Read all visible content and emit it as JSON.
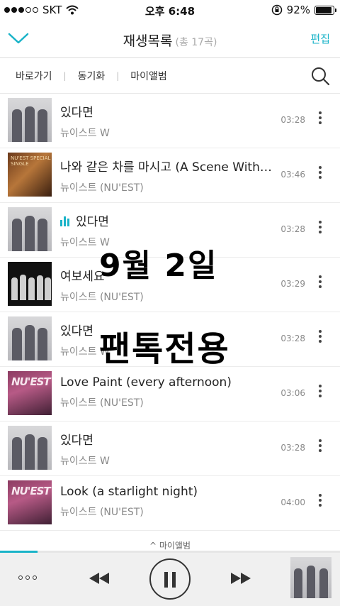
{
  "status_bar": {
    "carrier": "SKT",
    "time": "오후 6:48",
    "battery": "92%",
    "battery_level": 0.92
  },
  "header": {
    "title": "재생목록",
    "count": "(총 17곡)",
    "edit_label": "편집"
  },
  "subnav": {
    "links": [
      "바로가기",
      "동기화",
      "마이앨범"
    ]
  },
  "playlist": [
    {
      "title": "있다면",
      "artist": "뉴이스트 W",
      "duration": "03:28",
      "playing": false
    },
    {
      "title": "나와 같은 차를 마시고 (A Scene With You)",
      "artist": "뉴이스트 (NU'EST)",
      "duration": "03:46",
      "playing": false
    },
    {
      "title": "있다면",
      "artist": "뉴이스트 W",
      "duration": "03:28",
      "playing": true
    },
    {
      "title": "여보세요",
      "artist": "뉴이스트 (NU'EST)",
      "duration": "03:29",
      "playing": false
    },
    {
      "title": "있다면",
      "artist": "뉴이스트 W",
      "duration": "03:28",
      "playing": false
    },
    {
      "title": "Love Paint (every afternoon)",
      "artist": "뉴이스트 (NU'EST)",
      "duration": "03:06",
      "playing": false
    },
    {
      "title": "있다면",
      "artist": "뉴이스트 W",
      "duration": "03:28",
      "playing": false
    },
    {
      "title": "Look (a starlight night)",
      "artist": "뉴이스트 (NU'EST)",
      "duration": "04:00",
      "playing": false
    }
  ],
  "album_labels": {
    "scene": "NU'EST SPECIAL SINGLE",
    "lovepaint": "NU'EST"
  },
  "overlay": {
    "line1": "9월 2일",
    "line2": "팬톡전용"
  },
  "my_album_label": "^ 마이앨범",
  "player": {
    "progress": 0.11
  },
  "colors": {
    "accent": "#19b3c8"
  }
}
